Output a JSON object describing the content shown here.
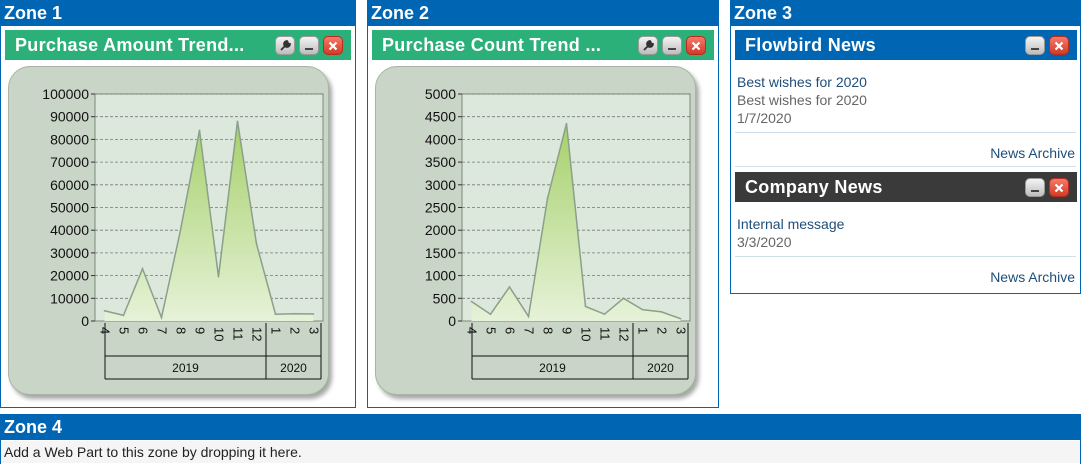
{
  "zones": {
    "z1": "Zone 1",
    "z2": "Zone 2",
    "z3": "Zone 3",
    "z4": "Zone 4"
  },
  "webparts": {
    "purchase_amount": {
      "title": "Purchase Amount Trend..."
    },
    "purchase_count": {
      "title": "Purchase Count Trend ..."
    },
    "flowbird_news": {
      "title": "Flowbird News"
    },
    "company_news": {
      "title": "Company News"
    }
  },
  "flowbird_news": {
    "item_link": "Best wishes for 2020",
    "item_desc": "Best wishes for 2020",
    "item_date": "1/7/2020",
    "archive": "News Archive"
  },
  "company_news": {
    "item_link": "Internal message",
    "item_date": "3/3/2020",
    "archive": "News Archive"
  },
  "zone4": {
    "hint": "Add a Web Part to this zone by dropping it here."
  },
  "colors": {
    "zone_blue": "#0066b3",
    "wp_green": "#2bb07a",
    "wp_dark": "#3a3a3a",
    "chart_bg": "#dce8dc",
    "area_fill": "#a6d06a"
  },
  "icons": {
    "wrench": "wrench-icon",
    "minimize": "minimize-icon",
    "close": "close-icon"
  },
  "chart_data": [
    {
      "type": "area",
      "title": "Purchase Amount Trend...",
      "x": [
        "4",
        "5",
        "6",
        "7",
        "8",
        "9",
        "10",
        "11",
        "12",
        "1",
        "2",
        "3"
      ],
      "groups": [
        {
          "label": "2019",
          "count": 9
        },
        {
          "label": "2020",
          "count": 3
        }
      ],
      "values": [
        4500,
        2500,
        23000,
        1500,
        40000,
        84000,
        19500,
        88000,
        34000,
        3000,
        3200,
        3100
      ],
      "ylim": [
        0,
        100000
      ],
      "yticks": [
        "0",
        "10000",
        "20000",
        "30000",
        "40000",
        "50000",
        "60000",
        "70000",
        "80000",
        "90000",
        "100000"
      ],
      "grid": true
    },
    {
      "type": "area",
      "title": "Purchase Count Trend ...",
      "x": [
        "4",
        "5",
        "6",
        "7",
        "8",
        "9",
        "10",
        "11",
        "12",
        "1",
        "2",
        "3"
      ],
      "groups": [
        {
          "label": "2019",
          "count": 9
        },
        {
          "label": "2020",
          "count": 3
        }
      ],
      "values": [
        430,
        150,
        750,
        100,
        2700,
        4350,
        320,
        150,
        500,
        250,
        200,
        50
      ],
      "ylim": [
        0,
        5000
      ],
      "yticks": [
        "0",
        "500",
        "1000",
        "1500",
        "2000",
        "2500",
        "3000",
        "3500",
        "4000",
        "4500",
        "5000"
      ],
      "grid": true
    }
  ]
}
